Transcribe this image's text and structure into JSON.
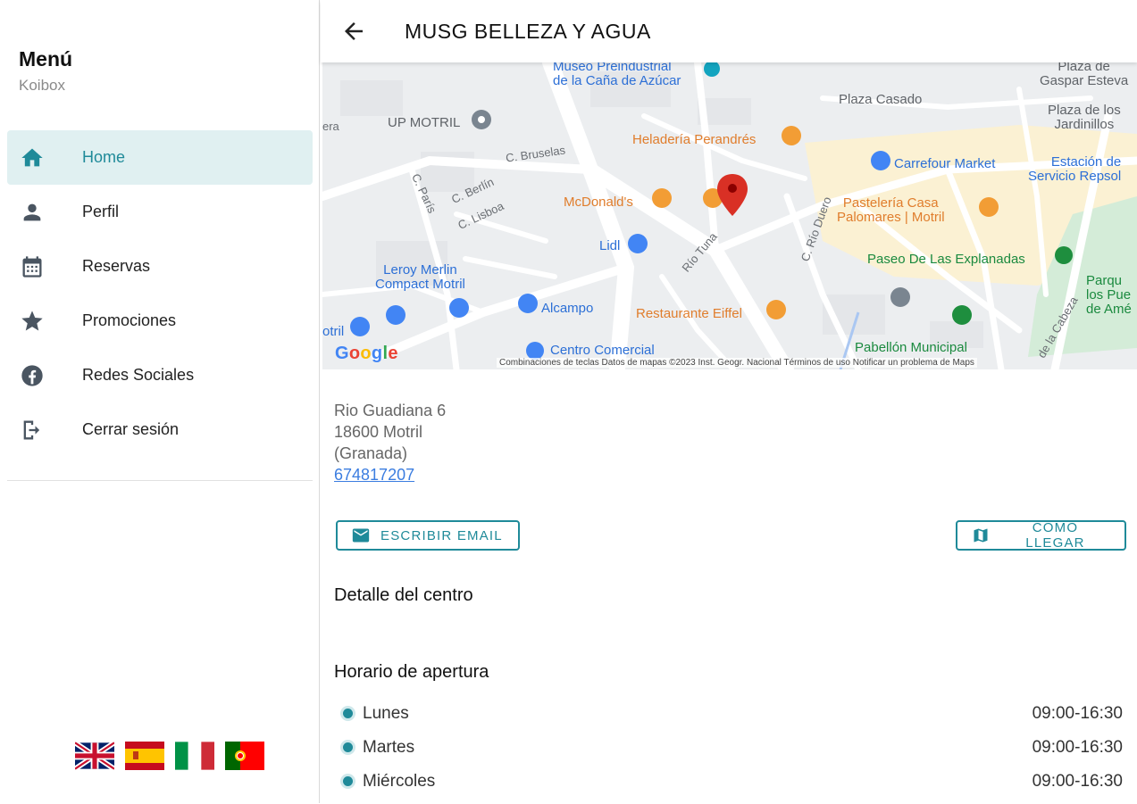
{
  "sidebar": {
    "title": "Menú",
    "subtitle": "Koibox",
    "items": [
      {
        "label": "Home",
        "icon": "home-icon",
        "active": true
      },
      {
        "label": "Perfil",
        "icon": "person-icon",
        "active": false
      },
      {
        "label": "Reservas",
        "icon": "calendar-icon",
        "active": false
      },
      {
        "label": "Promociones",
        "icon": "star-icon",
        "active": false
      },
      {
        "label": "Redes Sociales",
        "icon": "facebook-icon",
        "active": false
      },
      {
        "label": "Cerrar sesión",
        "icon": "logout-icon",
        "active": false
      }
    ],
    "flags": [
      "uk-flag",
      "spain-flag",
      "italy-flag",
      "portugal-flag"
    ]
  },
  "header": {
    "title": "MUSG BELLEZA Y AGUA",
    "back_icon": "arrow-back-icon"
  },
  "map": {
    "labels": {
      "museo": "Museo Preindustrial\nde la Caña de Azúcar",
      "up_motril": "UP MOTRIL",
      "plaza_casado": "Plaza Casado",
      "plaza_gaspar": "Plaza de\nGaspar Esteva",
      "plaza_jardinillos": "Plaza de los\nJardinillos",
      "heladeria": "Heladería Perandrés",
      "carrefour": "Carrefour Market",
      "repsol": "Estación de\nServicio Repsol",
      "mcdonalds": "McDonald's",
      "pasteleria": "Pastelería Casa\nPalomares | Motril",
      "lidl": "Lidl",
      "leroy": "Leroy Merlin\nCompact Motril",
      "alcampo": "Alcampo",
      "restaurante": "Restaurante Eiffel",
      "paseo": "Paseo De Las Explanadas",
      "parque": "Parqu\nlos Pue\nde Amé",
      "pabellon": "Pabellón Municipal",
      "centro": "Centro Comercial",
      "motril": "otril",
      "c_bruselas": "C. Bruselas",
      "c_berlin": "C. Berlín",
      "c_lisboa": "C. Lisboa",
      "c_paris": "C. París",
      "rio_tuna": "Río Tuna",
      "c_rio_duero": "C. Río Duero",
      "cabeza": "de la Cabeza",
      "era": "era"
    },
    "google_logo": "Google",
    "footer": "Combinaciones de teclas   Datos de mapas ©2023 Inst. Geogr. Nacional   Términos de uso   Notificar un problema de Maps"
  },
  "address": {
    "line1": "Rio Guadiana 6",
    "line2": "18600 Motril",
    "line3": "(Granada)",
    "phone": "674817207"
  },
  "actions": {
    "email_label": "ESCRIBIR EMAIL",
    "route_label": "COMO LLEGAR"
  },
  "sections": {
    "detail_title": "Detalle del centro",
    "hours_title": "Horario de apertura"
  },
  "hours": [
    {
      "day": "Lunes",
      "time": "09:00-16:30"
    },
    {
      "day": "Martes",
      "time": "09:00-16:30"
    },
    {
      "day": "Miércoles",
      "time": "09:00-16:30"
    }
  ],
  "colors": {
    "accent": "#1f8a99",
    "active_bg": "#e0f0f1",
    "link": "#3b7de0",
    "map_pin": "#d93025"
  }
}
